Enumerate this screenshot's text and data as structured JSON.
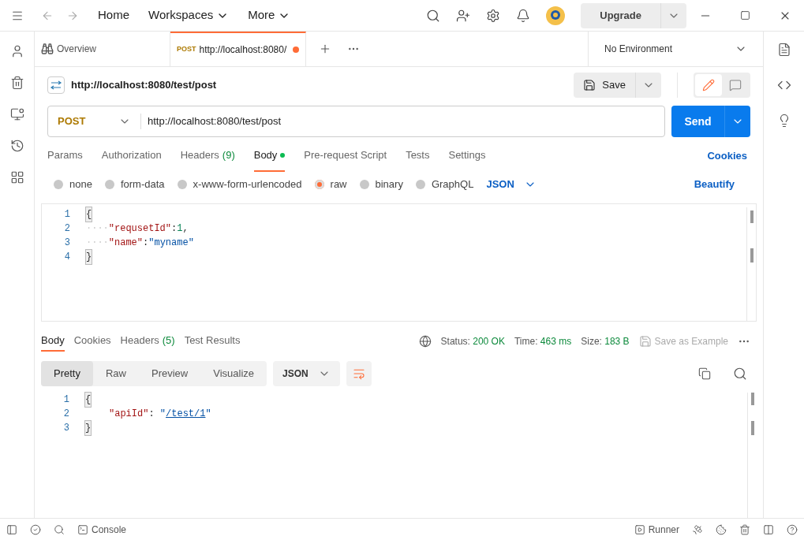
{
  "top_nav": {
    "items": [
      {
        "label": "Home",
        "dropdown": false
      },
      {
        "label": "Workspaces",
        "dropdown": true
      },
      {
        "label": "More",
        "dropdown": true
      }
    ],
    "upgrade": "Upgrade"
  },
  "tabs": [
    {
      "kind": "overview",
      "label": "Overview",
      "selected": false
    },
    {
      "kind": "request",
      "method": "POST",
      "label": "http://localhost:8080/",
      "selected": true,
      "unsaved": true
    }
  ],
  "environment": "No Environment",
  "request": {
    "title": "http://localhost:8080/test/post",
    "save": "Save",
    "method": "POST",
    "url": "http://localhost:8080/test/post",
    "send": "Send"
  },
  "request_tabs": [
    {
      "label": "Params",
      "selected": false
    },
    {
      "label": "Authorization",
      "selected": false
    },
    {
      "label": "Headers",
      "count": "(9)",
      "selected": false
    },
    {
      "label": "Body",
      "selected": true,
      "dot": true
    },
    {
      "label": "Pre-request Script",
      "selected": false
    },
    {
      "label": "Tests",
      "selected": false
    },
    {
      "label": "Settings",
      "selected": false
    }
  ],
  "cookies": "Cookies",
  "body_types": [
    {
      "label": "none",
      "selected": false
    },
    {
      "label": "form-data",
      "selected": false
    },
    {
      "label": "x-www-form-urlencoded",
      "selected": false
    },
    {
      "label": "raw",
      "selected": true
    },
    {
      "label": "binary",
      "selected": false
    },
    {
      "label": "GraphQL",
      "selected": false
    }
  ],
  "body_language": "JSON",
  "beautify": "Beautify",
  "request_body": [
    {
      "number": "1",
      "tokens": [
        {
          "kind": "bracket",
          "text": "{"
        }
      ]
    },
    {
      "number": "2",
      "tokens": [
        {
          "kind": "whitespace",
          "text": "····"
        },
        {
          "kind": "key",
          "text": "\"requsetId\""
        },
        {
          "kind": "punct",
          "text": ":"
        },
        {
          "kind": "number",
          "text": "1"
        },
        {
          "kind": "punct",
          "text": ","
        }
      ]
    },
    {
      "number": "3",
      "tokens": [
        {
          "kind": "whitespace",
          "text": "····"
        },
        {
          "kind": "key",
          "text": "\"name\""
        },
        {
          "kind": "punct",
          "text": ":"
        },
        {
          "kind": "string",
          "text": "\"myname\""
        }
      ]
    },
    {
      "number": "4",
      "tokens": [
        {
          "kind": "bracket",
          "text": "}"
        }
      ]
    }
  ],
  "response_tabs": [
    {
      "label": "Body",
      "selected": true
    },
    {
      "label": "Cookies",
      "selected": false
    },
    {
      "label": "Headers",
      "count": "(5)",
      "selected": false
    },
    {
      "label": "Test Results",
      "selected": false
    }
  ],
  "response_meta": [
    {
      "label": "Status:",
      "value": "200 OK"
    },
    {
      "label": "Time:",
      "value": "463 ms"
    },
    {
      "label": "Size:",
      "value": "183 B"
    }
  ],
  "save_example": "Save as Example",
  "view_modes": [
    {
      "label": "Pretty",
      "selected": true
    },
    {
      "label": "Raw",
      "selected": false
    },
    {
      "label": "Preview",
      "selected": false
    },
    {
      "label": "Visualize",
      "selected": false
    }
  ],
  "response_language": "JSON",
  "response_body": [
    {
      "number": "1",
      "tokens": [
        {
          "kind": "bracket",
          "text": "{"
        }
      ]
    },
    {
      "number": "2",
      "indented": true,
      "tokens": [
        {
          "kind": "key",
          "text": "\"apiId\""
        },
        {
          "kind": "punct",
          "text": ": "
        },
        {
          "kind": "string",
          "text": "\""
        },
        {
          "kind": "link",
          "text": "/test/1"
        },
        {
          "kind": "string",
          "text": "\""
        }
      ]
    },
    {
      "number": "3",
      "tokens": [
        {
          "kind": "bracket",
          "text": "}"
        }
      ]
    }
  ],
  "status_bar": {
    "console": "Console",
    "runner": "Runner"
  }
}
